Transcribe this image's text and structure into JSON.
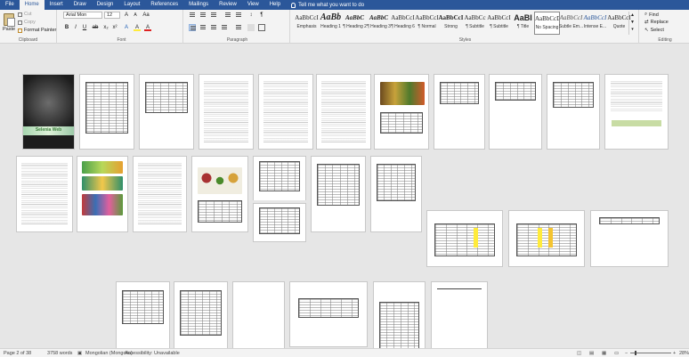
{
  "ribbon": {
    "tabs": [
      "File",
      "Home",
      "Insert",
      "Draw",
      "Design",
      "Layout",
      "References",
      "Mailings",
      "Review",
      "View",
      "Help"
    ],
    "active_tab": "Home",
    "tell_me": "Tell me what you want to do",
    "clipboard": {
      "paste": "Paste",
      "cut": "Cut",
      "copy": "Copy",
      "format_painter": "Format Painter",
      "label": "Clipboard"
    },
    "font": {
      "name": "Arial Mon",
      "size": "12",
      "label": "Font",
      "bold": "B",
      "italic": "I",
      "underline": "U",
      "strike": "ab",
      "subscript": "x₂",
      "superscript": "x²",
      "grow": "A",
      "shrink": "A",
      "case": "Aa",
      "highlight": "A"
    },
    "paragraph": {
      "label": "Paragraph",
      "pilcrow": "¶"
    },
    "styles": {
      "label": "Styles",
      "items": [
        {
          "sample": "AaBbCcI",
          "name": "Emphasis"
        },
        {
          "sample": "AaBb",
          "name": "Heading 1"
        },
        {
          "sample": "AaBbC",
          "name": "¶ Heading 2"
        },
        {
          "sample": "AaBbC",
          "name": "¶ Heading 3"
        },
        {
          "sample": "AaBbCcI",
          "name": "¶ Heading 6"
        },
        {
          "sample": "AaBbCcI",
          "name": "¶ Normal"
        },
        {
          "sample": "AaBbCcI",
          "name": "Strong"
        },
        {
          "sample": "AaBbCc",
          "name": "¶ Subtitle"
        },
        {
          "sample": "AaBbCcI",
          "name": "¶ Subtitle"
        },
        {
          "sample": "AaBI",
          "name": "¶ Title"
        },
        {
          "sample": "AaBbCcDc",
          "name": "No Spacing"
        },
        {
          "sample": "AaBbCcI",
          "name": "Subtle Em..."
        },
        {
          "sample": "AaBbCcI",
          "name": "Intense E..."
        },
        {
          "sample": "AaBbCcI",
          "name": "Quote"
        }
      ],
      "selected_index": 10
    },
    "editing": {
      "find": "Find",
      "replace": "Replace",
      "select": "Select",
      "label": "Editing"
    }
  },
  "status": {
    "page": "Page 2 of 38",
    "words": "3758 words",
    "language": "Mongolian (Mongolia)",
    "accessibility": "Accessibility: Unavailable",
    "zoom": "28%"
  },
  "cover_text": "Selenia Web",
  "colors": {
    "ribbon_blue": "#2b579a",
    "highlight_yellow": "#ffeb3b"
  }
}
